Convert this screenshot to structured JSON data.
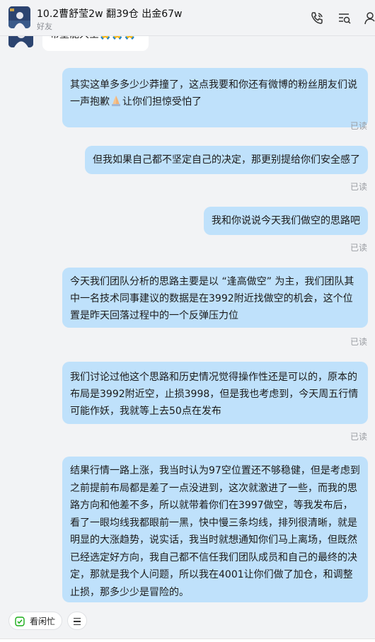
{
  "header": {
    "title": "10.2曹舒莹2w 翻39仓 出金67w",
    "subtitle": "好友"
  },
  "peer_message": {
    "text": "希望能大空🙏🙏🙏"
  },
  "messages": [
    {
      "text": "其实这单多多少少莽撞了，这点我要和你还有微博的粉丝朋友们说一声抱歉",
      "text_after": "让你们担惊受怕了",
      "read": "已读"
    },
    {
      "text": "但我如果自己都不坚定自己的决定，那更别提给你们安全感了",
      "read": "已读"
    },
    {
      "text": "我和你说说今天我们做空的思路吧",
      "read": "已读"
    },
    {
      "text": "今天我们团队分析的思路主要是以 “逢高做空” 为主，我们团队其中一名技术同事建议的数据是在3992附近找做空的机会，这个位置是昨天回落过程中的一个反弹压力位",
      "read": "已读"
    },
    {
      "text": "我们讨论过他这个思路和历史情况觉得操作性还是可以的，原本的布局是3992附近空，止损3998，但是我也考虑到，今天周五行情可能作妖，我就等上去50点在发布",
      "read": "已读"
    },
    {
      "text": "结果行情一路上涨，我当时认为97空位置还不够稳健，但是考虑到之前提前布局都是差了一点没进到，这次就激进了一些，而我的思路方向和他差不多，所以就带着你们在3997做空，等我发布后，看了一眼均线我都眼前一黑，快中慢三条均线，排列很清晰，就是明显的大涨趋势，说实话，我当时就想通知你们马上离场，但既然已经选定好方向，我自己都不信任我们团队成员和自己的最终的决定，那就是我个人问题，所以我在4001让你们做了加仓，和调整止损，那多少少是冒险的。"
    }
  ],
  "bottom": {
    "status_label": "看闲忙"
  }
}
